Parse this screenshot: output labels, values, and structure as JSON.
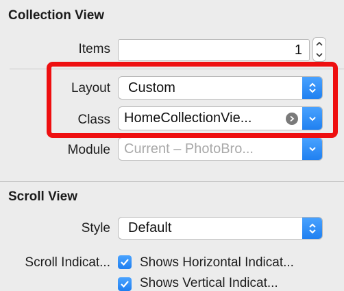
{
  "collection_view": {
    "title": "Collection View",
    "items": {
      "label": "Items",
      "value": "1"
    },
    "layout": {
      "label": "Layout",
      "value": "Custom"
    },
    "class": {
      "label": "Class",
      "value": "HomeCollectionVie..."
    },
    "module": {
      "label": "Module",
      "value": "Current – PhotoBro..."
    }
  },
  "scroll_view": {
    "title": "Scroll View",
    "style": {
      "label": "Style",
      "value": "Default"
    },
    "scroll_indicators": {
      "label": "Scroll Indicat...",
      "horizontal_label": "Shows Horizontal Indicat...",
      "vertical_label": "Shows Vertical Indicat..."
    }
  },
  "colors": {
    "panel_background": "#ececec",
    "accent_blue": "#1f7ff0",
    "highlight_red": "#ee0f10"
  }
}
